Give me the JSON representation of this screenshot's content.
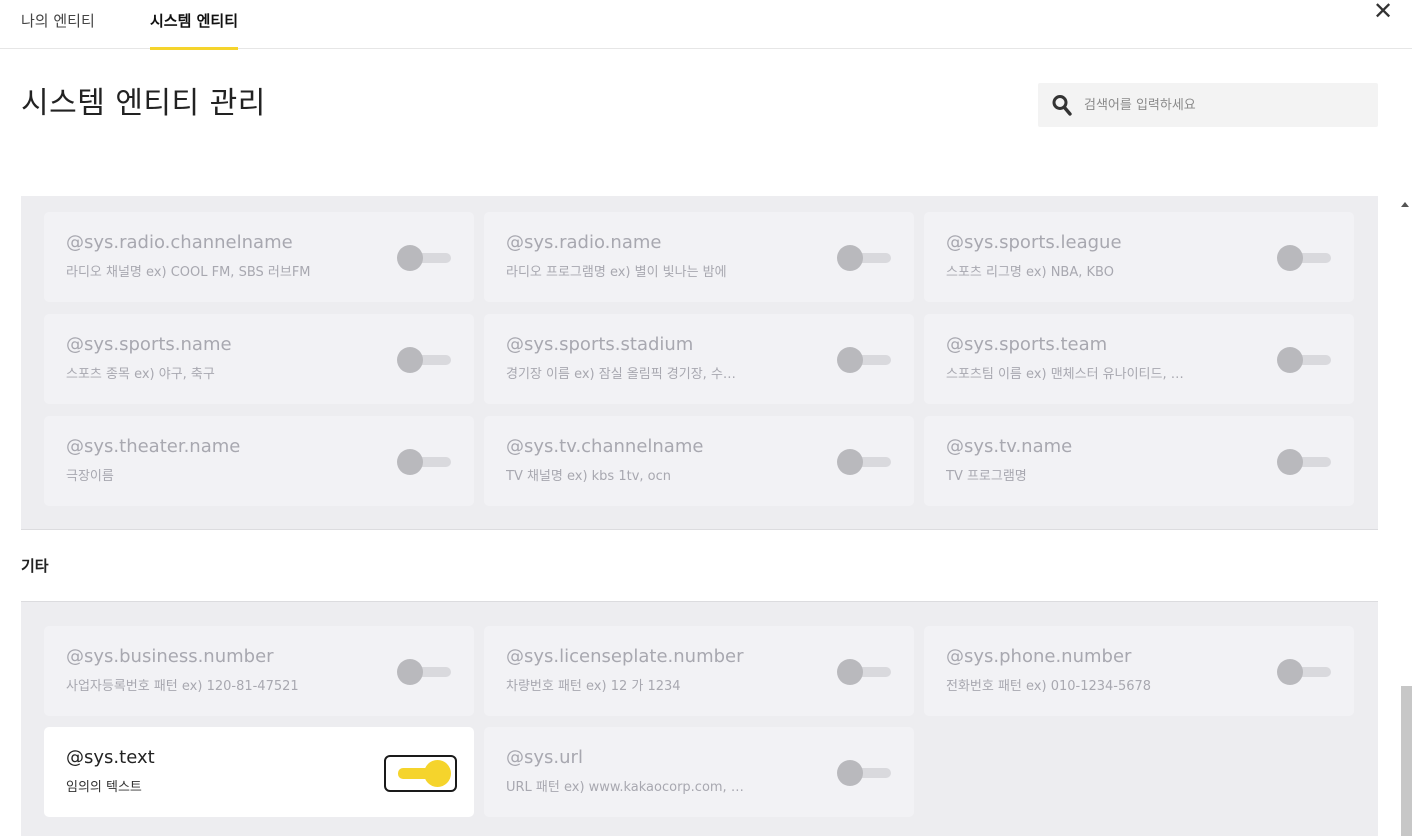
{
  "tabs": [
    {
      "label": "나의 엔티티",
      "active": false
    },
    {
      "label": "시스템 엔티티",
      "active": true
    }
  ],
  "close_icon": "close-icon",
  "page": {
    "title": "시스템 엔티티 관리"
  },
  "search": {
    "placeholder": "검색어를 입력하세요",
    "value": "",
    "icon": "search-icon"
  },
  "colors": {
    "accent": "#f5d42c",
    "panel": "#ededf0",
    "card": "#f2f2f5",
    "disabled_text": "#a8a8b0"
  },
  "groups": [
    {
      "label": "",
      "entities": [
        {
          "name": "@sys.radio.channelname",
          "desc": "라디오 채널명 ex) COOL FM, SBS 러브FM",
          "enabled": false
        },
        {
          "name": "@sys.radio.name",
          "desc": "라디오 프로그램명 ex) 별이 빛나는 밤에",
          "enabled": false
        },
        {
          "name": "@sys.sports.league",
          "desc": "스포츠 리그명 ex) NBA, KBO",
          "enabled": false
        },
        {
          "name": "@sys.sports.name",
          "desc": "스포츠 종목 ex) 야구, 축구",
          "enabled": false
        },
        {
          "name": "@sys.sports.stadium",
          "desc": "경기장 이름 ex) 잠실 올림픽 경기장, 수…",
          "enabled": false
        },
        {
          "name": "@sys.sports.team",
          "desc": "스포츠팀 이름 ex) 맨체스터 유나이티드, …",
          "enabled": false
        },
        {
          "name": "@sys.theater.name",
          "desc": "극장이름",
          "enabled": false
        },
        {
          "name": "@sys.tv.channelname",
          "desc": "TV 채널명 ex) kbs 1tv, ocn",
          "enabled": false
        },
        {
          "name": "@sys.tv.name",
          "desc": "TV 프로그램명",
          "enabled": false
        }
      ]
    },
    {
      "label": "기타",
      "entities": [
        {
          "name": "@sys.business.number",
          "desc": "사업자등록번호 패턴 ex) 120-81-47521",
          "enabled": false
        },
        {
          "name": "@sys.licenseplate.number",
          "desc": "차량번호 패턴 ex) 12 가 1234",
          "enabled": false
        },
        {
          "name": "@sys.phone.number",
          "desc": "전화번호 패턴 ex) 010-1234-5678",
          "enabled": false
        },
        {
          "name": "@sys.text",
          "desc": "임의의 텍스트",
          "enabled": true
        },
        {
          "name": "@sys.url",
          "desc": "URL 패턴 ex) www.kakaocorp.com, …",
          "enabled": false
        }
      ]
    }
  ]
}
